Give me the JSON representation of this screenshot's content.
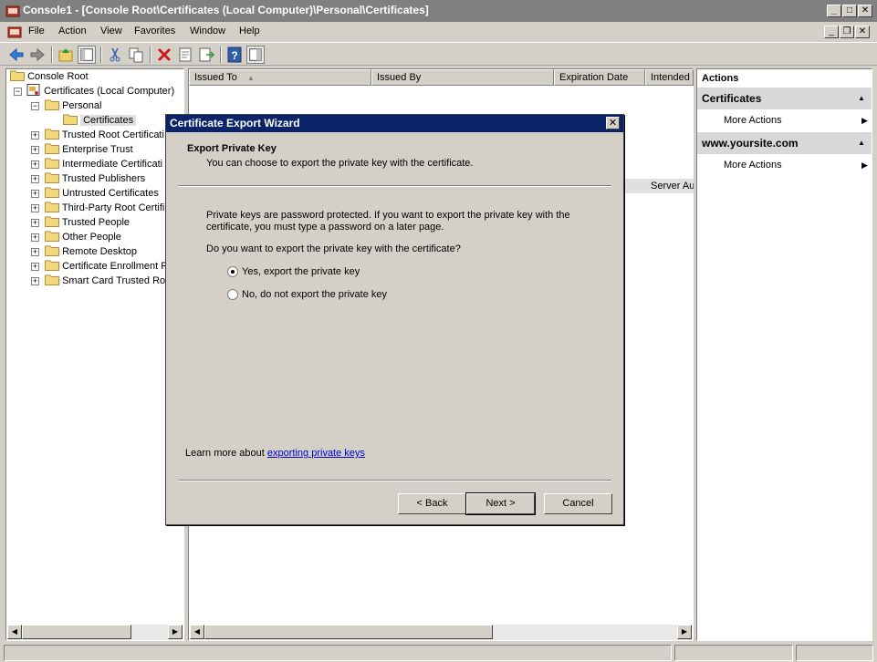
{
  "window": {
    "title": "Console1 - [Console Root\\Certificates (Local Computer)\\Personal\\Certificates]"
  },
  "menu": {
    "items": [
      "File",
      "Action",
      "View",
      "Favorites",
      "Window",
      "Help"
    ]
  },
  "tree": {
    "root": "Console Root",
    "certs": "Certificates (Local Computer)",
    "personal": "Personal",
    "certificates": "Certificates",
    "stores": [
      "Trusted Root Certificati",
      "Enterprise Trust",
      "Intermediate Certificati",
      "Trusted Publishers",
      "Untrusted Certificates",
      "Third-Party Root Certifi",
      "Trusted People",
      "Other People",
      "Remote Desktop",
      "Certificate Enrollment R",
      "Smart Card Trusted Roo"
    ]
  },
  "list": {
    "columns": [
      "Issued To",
      "Issued By",
      "Expiration Date",
      "Intended"
    ],
    "row_partial": "Server Au"
  },
  "actions": {
    "header": "Actions",
    "sections": [
      {
        "title": "Certificates",
        "item": "More Actions"
      },
      {
        "title": "www.yoursite.com",
        "item": "More Actions"
      }
    ]
  },
  "dialog": {
    "title": "Certificate Export Wizard",
    "heading": "Export Private Key",
    "subheading": "You can choose to export the private key with the certificate.",
    "body1": "Private keys are password protected. If you want to export the private key with the",
    "body2": "certificate, you must type a password on a later page.",
    "question": "Do you want to export the private key with the certificate?",
    "option_yes": "Yes, export the private key",
    "option_no": "No, do not export the private key",
    "selected": "yes",
    "learn_prefix": "Learn more about",
    "learn_link": "exporting private keys",
    "back": "< Back",
    "next": "Next >",
    "cancel": "Cancel"
  }
}
